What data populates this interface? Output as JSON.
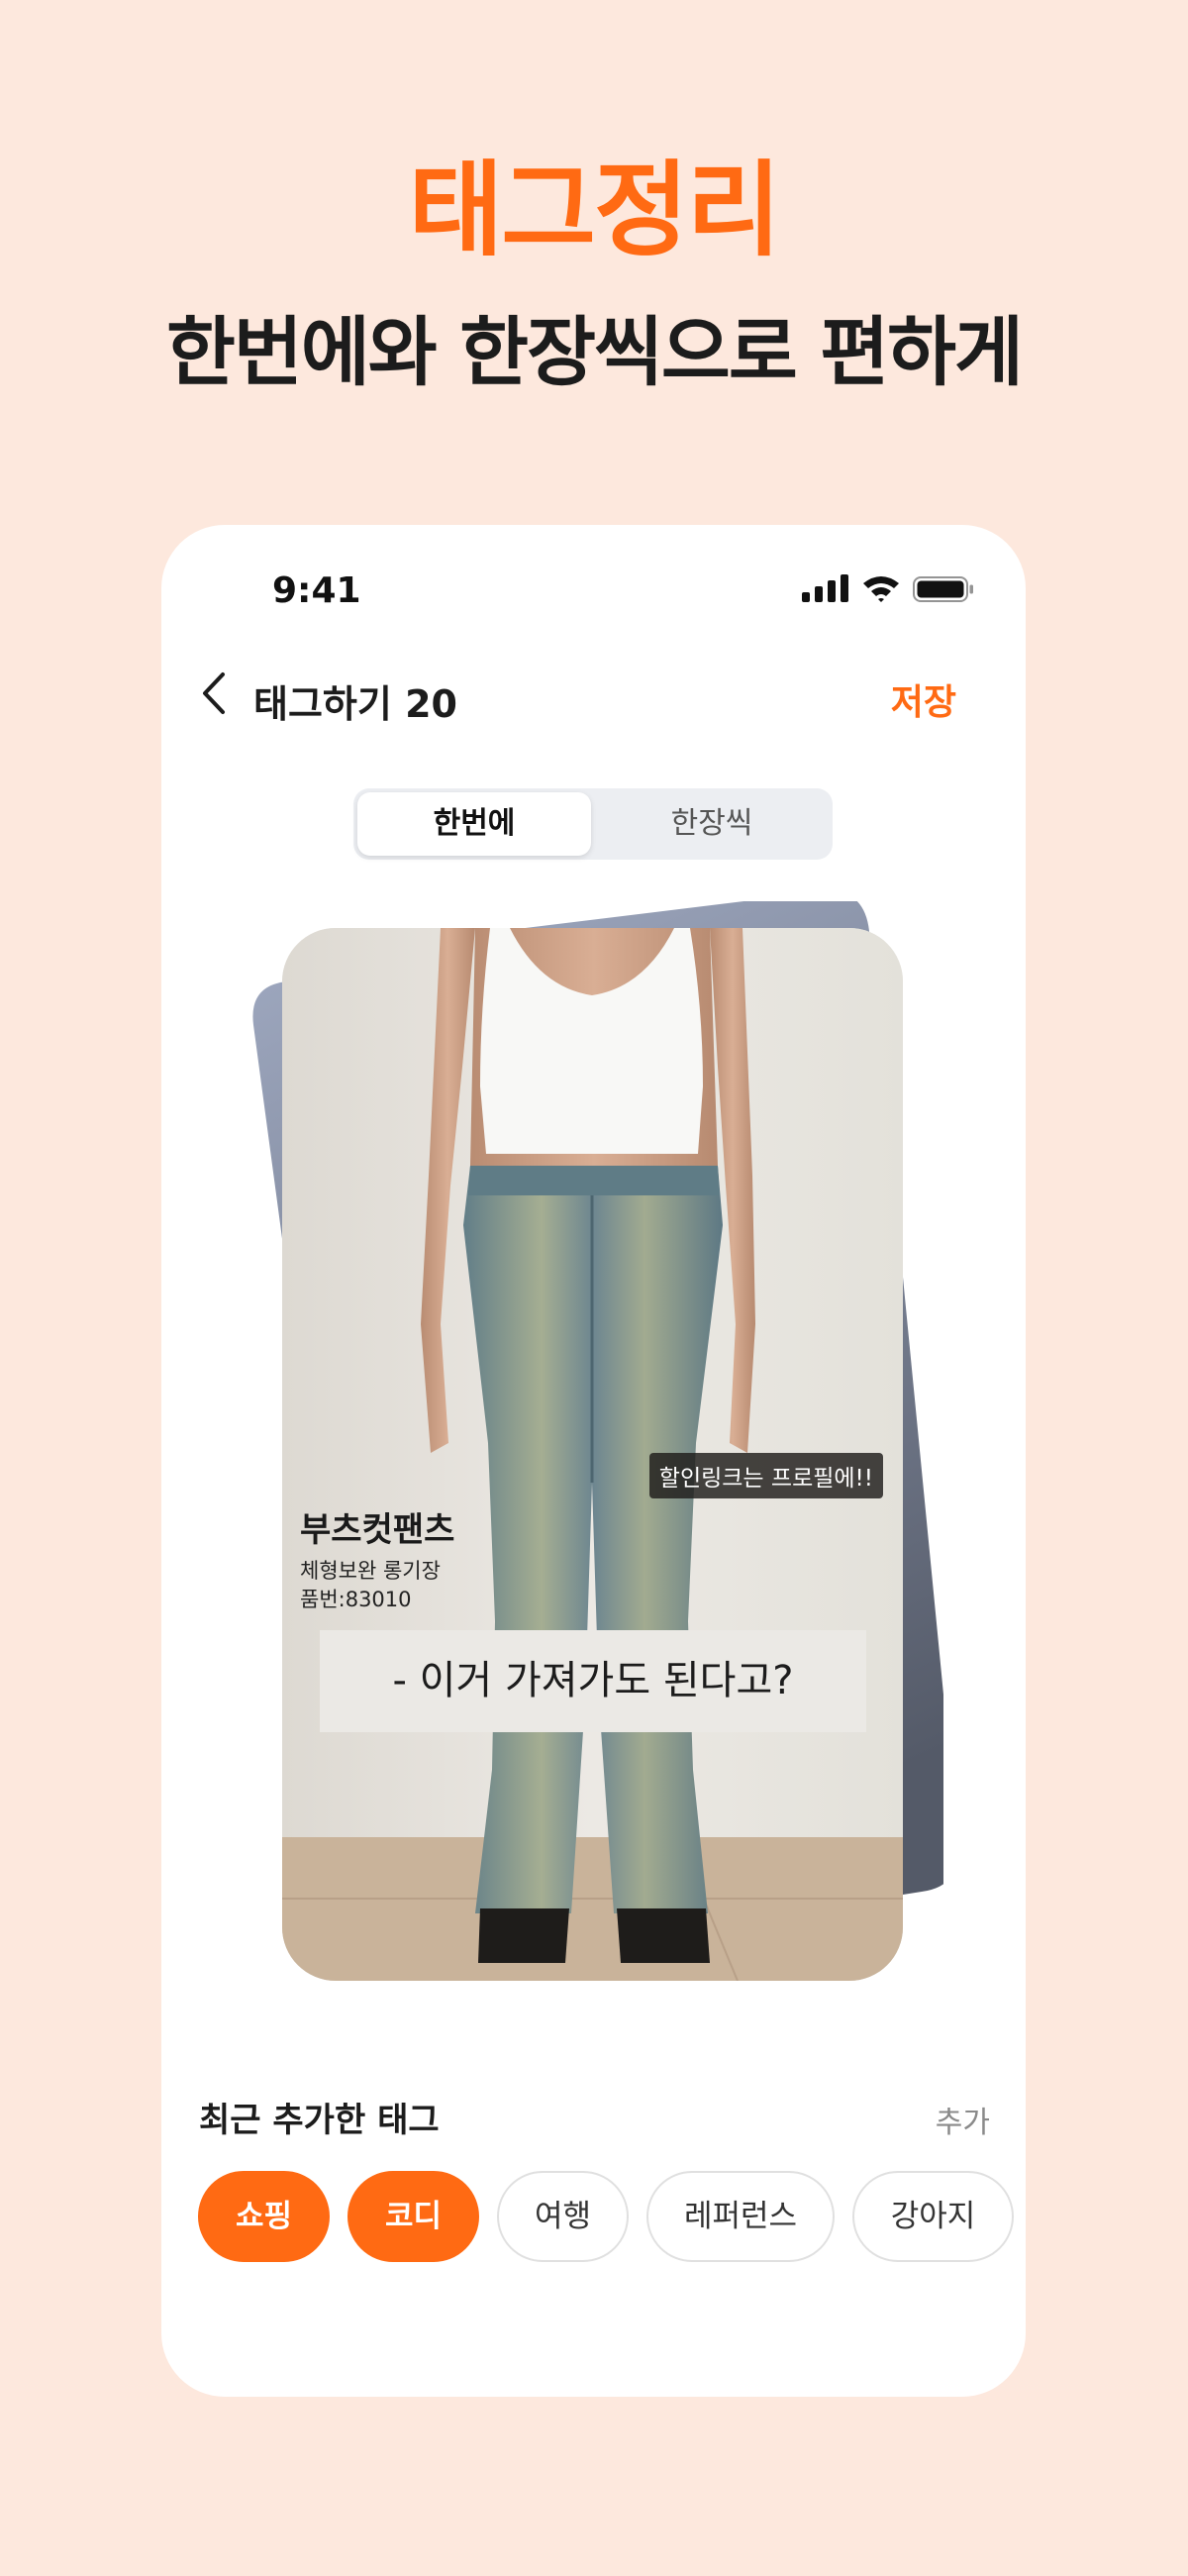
{
  "headline": "태그정리",
  "subheadline": "한번에와 한장씩으로 편하게",
  "status_bar": {
    "time": "9:41",
    "icons": [
      "signal-icon",
      "wifi-icon",
      "battery-icon"
    ]
  },
  "nav": {
    "title": "태그하기 20",
    "save_label": "저장"
  },
  "segment": {
    "options": [
      "한번에",
      "한장씩"
    ],
    "selected": "한번에"
  },
  "photo_card": {
    "promo_label": "할인링크는 프로필에!!",
    "product_name": "부츠컷팬츠",
    "product_desc": "체형보완  롱기장",
    "product_code": "품번:83010",
    "caption": "- 이거 가져가도 된다고?"
  },
  "tags_section": {
    "title": "최근 추가한 태그",
    "add_label": "추가",
    "tags": [
      {
        "label": "쇼핑",
        "selected": true
      },
      {
        "label": "코디",
        "selected": true
      },
      {
        "label": "여행",
        "selected": false
      },
      {
        "label": "레퍼런스",
        "selected": false
      },
      {
        "label": "강아지",
        "selected": false
      }
    ]
  },
  "colors": {
    "accent": "#ff6a13",
    "background": "#fde8dd",
    "text": "#1c1c1c"
  }
}
